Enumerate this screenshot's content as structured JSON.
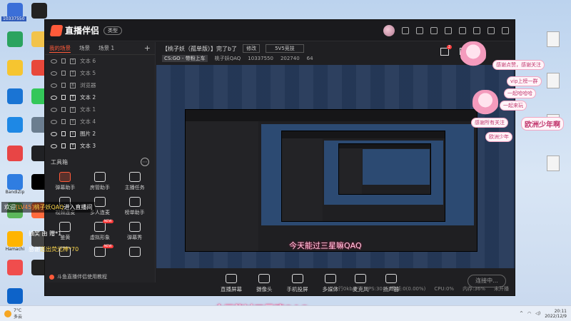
{
  "desktop": {
    "top_left_label": "10337550",
    "left_icons": [
      {
        "label": "",
        "color": "#3b6fd8"
      },
      {
        "label": "",
        "color": "#222"
      },
      {
        "label": "",
        "color": "#2ba35f"
      },
      {
        "label": "",
        "color": "#f2c34b"
      },
      {
        "label": "",
        "color": "#f6c530"
      },
      {
        "label": "",
        "color": "#e8483b"
      },
      {
        "label": "",
        "color": "#1a74d4"
      },
      {
        "label": "",
        "color": "#34c759"
      },
      {
        "label": "",
        "color": "#1e88e5"
      },
      {
        "label": "",
        "color": "#6b7d8f"
      },
      {
        "label": "",
        "color": "#e84545"
      },
      {
        "label": "",
        "color": "#202124"
      },
      {
        "label": "BandiZip",
        "color": "#2f7de1"
      },
      {
        "label": "",
        "color": "#000"
      },
      {
        "label": "",
        "color": "#5cb85c"
      },
      {
        "label": "",
        "color": "#ff6a3d"
      },
      {
        "label": "Hamachi",
        "color": "#ffb400"
      },
      {
        "label": "",
        "color": "#444"
      },
      {
        "label": "",
        "color": "#f04d4d"
      },
      {
        "label": "",
        "color": "#222"
      },
      {
        "label": "",
        "color": "#0d63c9"
      }
    ],
    "right_icons": [
      {
        "label": ""
      },
      {
        "label": ""
      },
      {
        "label": ""
      },
      {
        "label": ""
      }
    ]
  },
  "app": {
    "logo_text": "直播伴侣",
    "type_button": "类型",
    "scene_tabs": [
      "我的场景",
      "场景",
      "场景 1"
    ],
    "layers": [
      {
        "name": "文本 6",
        "visible": false,
        "type": "T"
      },
      {
        "name": "文本 5",
        "visible": false,
        "type": "T"
      },
      {
        "name": "浏览器",
        "visible": false,
        "type": "B"
      },
      {
        "name": "文本 2",
        "visible": true,
        "type": "T"
      },
      {
        "name": "文本 1",
        "visible": false,
        "type": "T"
      },
      {
        "name": "文本 4",
        "visible": false,
        "type": "T"
      },
      {
        "name": "图片 2",
        "visible": true,
        "type": "I"
      },
      {
        "name": "文本 3",
        "visible": true,
        "type": "T"
      }
    ],
    "toolbox_title": "工具箱",
    "tools": [
      {
        "label": "弹幕助手",
        "hot": true,
        "new": false
      },
      {
        "label": "房管助手",
        "hot": false,
        "new": false
      },
      {
        "label": "主播任务",
        "hot": false,
        "new": false
      },
      {
        "label": "视频连麦",
        "hot": false,
        "new": false
      },
      {
        "label": "多人连麦",
        "hot": false,
        "new": false
      },
      {
        "label": "榜单助手",
        "hot": false,
        "new": false
      },
      {
        "label": "鉴黄",
        "hot": false,
        "new": false
      },
      {
        "label": "虚拟形象",
        "hot": false,
        "new": true
      },
      {
        "label": "弹幕秀",
        "hot": false,
        "new": false
      },
      {
        "label": "",
        "hot": false,
        "new": false
      },
      {
        "label": "",
        "hot": false,
        "new": true
      },
      {
        "label": "",
        "hot": false,
        "new": false
      }
    ],
    "tutorial_text": "斗鱼直播伴侣使用教程",
    "room": {
      "title": "【桃子妖（孤单版）】完了b了",
      "edit_label": "修改",
      "category": "5V5竞技",
      "game": "CS:GO - 带粉上车",
      "streamer": "桃子妖QAQ",
      "room_id": "10337550",
      "fans": "202740",
      "viewers": "64"
    },
    "gift_badge": "2",
    "bottom_tools": [
      "直播屏幕",
      "摄像头",
      "手机投屏",
      "多媒体",
      "麦克风",
      "扬声器"
    ],
    "connect_button": "连接中...",
    "status": [
      "上行0kb/s",
      "FPS:30",
      "丢帧:0(0.00%)",
      "CPU:0%",
      "内存:36%",
      "未开播"
    ]
  },
  "overlays": {
    "chat1": {
      "prefix": "欢迎",
      "level": "[LV45]",
      "name": "桃子妖QAQ",
      "suffix": "进入直播间"
    },
    "chat2": "抽奖 由 赠*1",
    "chat3": {
      "prefix": "感谢",
      "gift": "送出荧光棒*70"
    },
    "mid_banner": "今天能过三星嘛QAQ",
    "bottom_banner": "今天能过三星嘛QAQ",
    "stickers": [
      "感谢点赞，感谢关注",
      "vip上榜一群",
      "一起哈哈哈",
      "一起来玩",
      "感谢所有关注",
      "欧洲少年啊",
      "欧洲少年"
    ]
  },
  "taskbar": {
    "weather": "7°C",
    "weather_desc": "多云",
    "time": "20:11",
    "date": "2022/12/9"
  }
}
